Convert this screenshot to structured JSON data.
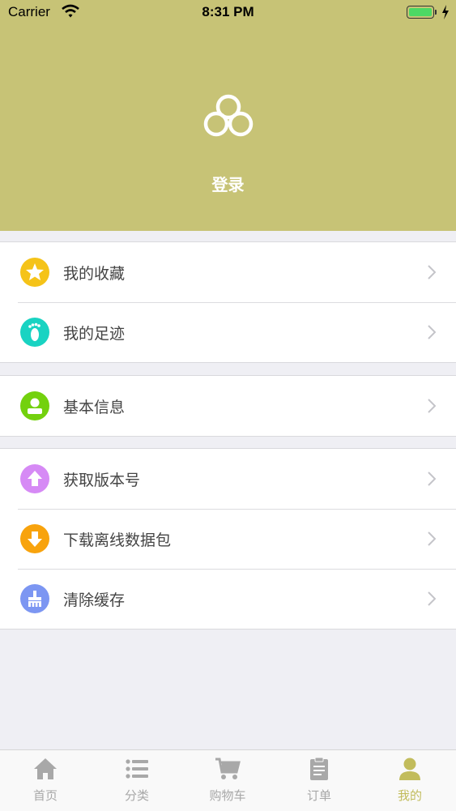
{
  "status_bar": {
    "carrier": "Carrier",
    "time": "8:31 PM"
  },
  "header": {
    "login_label": "登录"
  },
  "menu_groups": [
    [
      {
        "label": "我的收藏",
        "icon": "star-icon",
        "color": "#f5c318"
      },
      {
        "label": "我的足迹",
        "icon": "footprint-icon",
        "color": "#19d3c2"
      }
    ],
    [
      {
        "label": "基本信息",
        "icon": "user-icon",
        "color": "#73d10e"
      }
    ],
    [
      {
        "label": "获取版本号",
        "icon": "arrow-up-icon",
        "color": "#d68af5"
      },
      {
        "label": "下载离线数据包",
        "icon": "arrow-down-icon",
        "color": "#f8a30d"
      },
      {
        "label": "清除缓存",
        "icon": "broom-icon",
        "color": "#7c96f2"
      }
    ]
  ],
  "tabbar": {
    "tabs": [
      {
        "label": "首页",
        "icon": "home-icon"
      },
      {
        "label": "分类",
        "icon": "list-icon"
      },
      {
        "label": "购物车",
        "icon": "cart-icon"
      },
      {
        "label": "订单",
        "icon": "clipboard-icon"
      },
      {
        "label": "我的",
        "icon": "person-icon",
        "active": true
      }
    ],
    "active_color": "#c2bc5c",
    "inactive_color": "#a8a8a8"
  },
  "colors": {
    "header_bg": "#c7c376",
    "page_bg": "#efeff4"
  }
}
